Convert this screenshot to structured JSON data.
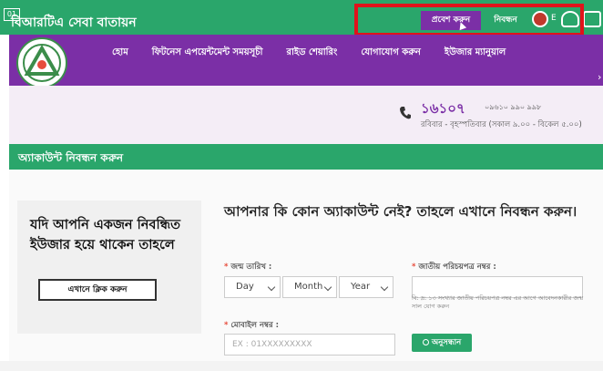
{
  "header": {
    "badge": "01",
    "site_title": "বিআরটিএ সেবা বাতায়ন",
    "login_label": "প্রবেশ করুন",
    "register_label": "নিবন্ধন",
    "lang_label": "E"
  },
  "nav": {
    "items": [
      {
        "label": "হোম"
      },
      {
        "label": "ফিটনেস এপয়েন্টমেন্ট সময়সূচী"
      },
      {
        "label": "রাইড শেয়ারিং"
      },
      {
        "label": "যোগাযোগ করুন"
      },
      {
        "label": "ইউজার ম্যানুয়াল"
      }
    ]
  },
  "contact": {
    "phone": "১৬১০৭",
    "phone_alt": "০৯৬১০ ৯৯০ ৯৯৮",
    "hours": "রবিবার - বৃহস্পতিবার (সকাল ৯.০০ - বিকেল ৫.০০)"
  },
  "section": {
    "title": "অ্যাকাউন্ট নিবন্ধন করুন"
  },
  "left_panel": {
    "text": "যদি আপনি একজন নিবন্ধিত ইউজার হয়ে থাকেন তাহলে",
    "button_label": "এখানে ক্লিক করুন"
  },
  "form": {
    "heading": "আপনার কি কোন অ্যাকাউন্ট নেই? তাহলে এখানে নিবন্ধন করুন।",
    "dob_label": "জন্ম তারিখ :",
    "day": "Day",
    "month": "Month",
    "year": "Year",
    "nid_label": "জাতীয় পরিচয়পত্র নম্বর :",
    "mobile_label": "মোবাইল নম্বর :",
    "mobile_placeholder": "EX : 01XXXXXXXXX",
    "hint": "বি: দ্র: ১৩ সংখ্যার জাতীয় পরিচয়পত্র নম্বর এর আগে আবেদনকারীর জন্ম সাল যোগ করুন",
    "search_label": "অনুসন্ধান"
  },
  "colors": {
    "green": "#2aa66b",
    "purple": "#7b2fa6",
    "highlight": "#e0131b"
  }
}
